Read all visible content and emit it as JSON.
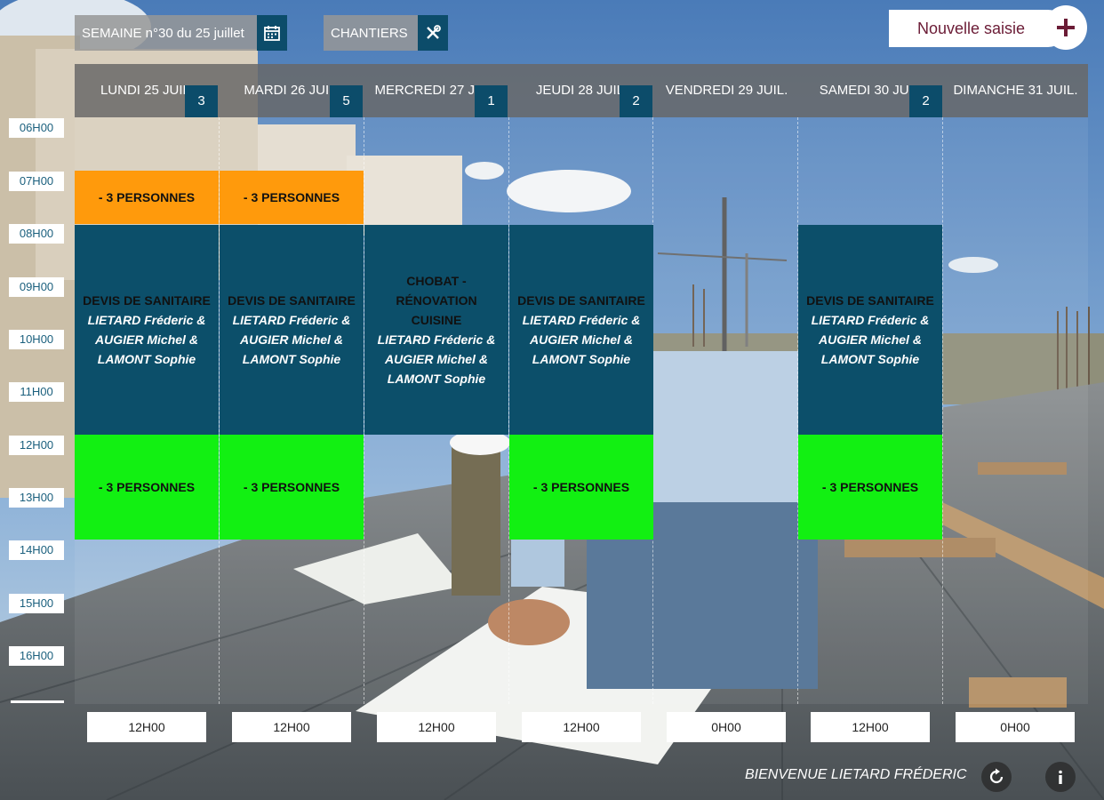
{
  "toolbar": {
    "week_label": "SEMAINE n°30 du 25 juillet",
    "sites_label": "CHANTIERS",
    "new_entry_label": "Nouvelle saisie",
    "calendar_icon": "calendar-icon",
    "tools_icon": "tools-icon",
    "plus_icon": "plus-icon"
  },
  "days": [
    {
      "name": "LUNDI 25 JUIL.",
      "badge": "3"
    },
    {
      "name": "MARDI 26 JUIL.",
      "badge": "5"
    },
    {
      "name": "MERCREDI 27 JUIL.",
      "badge": "1"
    },
    {
      "name": "JEUDI 28 JUIL.",
      "badge": "2"
    },
    {
      "name": "VENDREDI 29 JUIL.",
      "badge": ""
    },
    {
      "name": "SAMEDI 30 JUIL.",
      "badge": "2"
    },
    {
      "name": "DIMANCHE 31 JUIL.",
      "badge": ""
    }
  ],
  "hours": [
    "06H00",
    "07H00",
    "08H00",
    "09H00",
    "10H00",
    "11H00",
    "12H00",
    "13H00",
    "14H00",
    "15H00",
    "16H00"
  ],
  "events": {
    "mon_morning": "- 3 PERSONNES",
    "tue_morning": "- 3 PERSONNES",
    "mon_main": {
      "title": "DEVIS DE SANITAIRE",
      "people": "LIETARD Fréderic & AUGIER Michel & LAMONT Sophie"
    },
    "tue_main": {
      "title": "DEVIS DE SANITAIRE",
      "people": "LIETARD Fréderic & AUGIER Michel & LAMONT Sophie"
    },
    "wed_main": {
      "title": "CHOBAT - RÉNOVATION CUISINE",
      "people": "LIETARD Fréderic & AUGIER Michel & LAMONT Sophie"
    },
    "thu_main": {
      "title": "DEVIS DE SANITAIRE",
      "people": "LIETARD Fréderic & AUGIER Michel & LAMONT Sophie"
    },
    "sat_main": {
      "title": "DEVIS DE SANITAIRE",
      "people": "LIETARD Fréderic & AUGIER Michel & LAMONT Sophie"
    },
    "mon_afternoon": "- 3 PERSONNES",
    "tue_afternoon": "- 3 PERSONNES",
    "thu_afternoon": "- 3 PERSONNES",
    "sat_afternoon": "- 3 PERSONNES"
  },
  "totals": [
    "12H00",
    "12H00",
    "12H00",
    "12H00",
    "0H00",
    "12H00",
    "0H00"
  ],
  "footer": {
    "welcome": "BIENVENUE LIETARD FRÉDERIC",
    "refresh_icon": "refresh-icon",
    "info_icon": "info-icon"
  },
  "colors": {
    "accent": "#0c4c6a",
    "orange": "#ff9a0c",
    "green": "#12f012",
    "brand": "#6b1c36"
  }
}
